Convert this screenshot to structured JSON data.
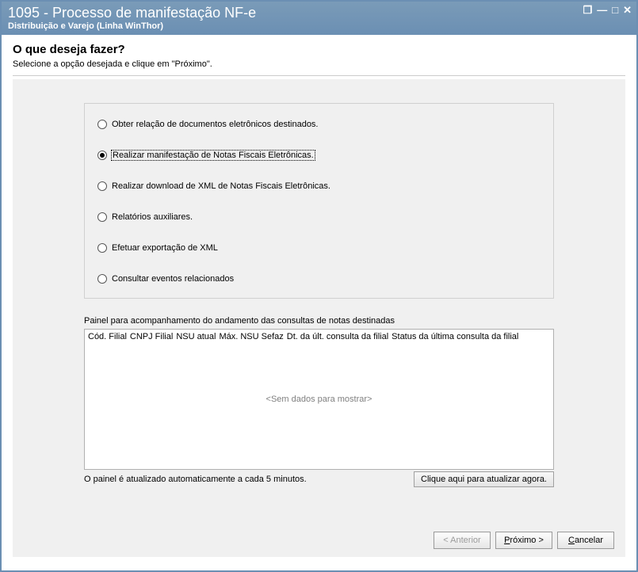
{
  "titlebar": {
    "title": "1095 - Processo de manifestação NF-e",
    "subtitle": "Distribuição e Varejo (Linha WinThor)"
  },
  "header": {
    "heading": "O que deseja fazer?",
    "subheading": "Selecione a opção desejada e clique em \"Próximo\"."
  },
  "options": [
    {
      "label": "Obter relação de documentos eletrônicos destinados.",
      "selected": false
    },
    {
      "label": "Realizar manifestação de Notas Fiscais Eletrônicas.",
      "selected": true
    },
    {
      "label": "Realizar download de XML de Notas Fiscais Eletrônicas.",
      "selected": false
    },
    {
      "label": "Relatórios auxiliares.",
      "selected": false
    },
    {
      "label": "Efetuar exportação de XML",
      "selected": false
    },
    {
      "label": "Consultar eventos relacionados",
      "selected": false
    }
  ],
  "panel": {
    "caption": "Painel para acompanhamento do andamento das consultas de notas destinadas",
    "columns": [
      "Cód. Filial",
      "CNPJ Filial",
      "NSU atual",
      "Máx. NSU Sefaz",
      "Dt. da últ. consulta da filial",
      "Status da última consulta da filial"
    ],
    "empty_text": "<Sem dados para mostrar>",
    "note": "O painel é atualizado automaticamente a cada 5 minutos.",
    "refresh_label": "Clique aqui para atualizar agora."
  },
  "wizard": {
    "back": "< Anterior",
    "next_prefix": "P",
    "next_rest": "róximo >",
    "cancel_prefix": "C",
    "cancel_rest": "ancelar"
  }
}
